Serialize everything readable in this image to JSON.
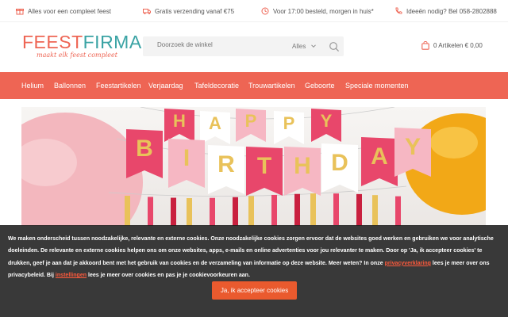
{
  "usp": [
    {
      "text": "Alles voor een compleet feest",
      "icon": "gift-icon"
    },
    {
      "text": "Gratis verzending vanaf €75",
      "icon": "truck-icon"
    },
    {
      "text": "Voor 17:00 besteld, morgen in huis*",
      "icon": "clock-icon"
    },
    {
      "text": "Ideeën nodig? Bel 058-2802888",
      "icon": "phone-icon"
    }
  ],
  "logo": {
    "part1": "FEEST",
    "part2": "FIRMA",
    "tagline": "maakt elk feest compleet"
  },
  "search": {
    "placeholder": "Doorzoek de winkel",
    "category": "Alles"
  },
  "cart": {
    "label": "0 Artikelen € 0,00"
  },
  "nav": [
    "Helium",
    "Ballonnen",
    "Feestartikelen",
    "Verjaardag",
    "Tafeldecoratie",
    "Trouwartikelen",
    "Geboorte",
    "Speciale momenten"
  ],
  "hero": {
    "flags_top": [
      "H",
      "A",
      "P",
      "P",
      "Y"
    ],
    "flags_bottom": [
      "B",
      "I",
      "R",
      "T",
      "H",
      "D",
      "A",
      "Y"
    ]
  },
  "cookie": {
    "p1": "We maken onderscheid tussen noodzakelijke, relevante en externe cookies. Onze noodzakelijke cookies zorgen ervoor dat de websites goed werken en gebruiken we voor analytische doeleinden. De relevante en externe cookies helpen ons om onze websites, apps, e-mails en online advertenties voor jou relevanter te maken. Door op 'Ja, ik accepteer cookies' te drukken, geef je aan dat je akkoord bent met het gebruik van cookies en de verzameling van informatie op deze website. Meer weten? In onze ",
    "link1": "privacyverklaring",
    "p2": " lees je meer over ons privacybeleid. Bij ",
    "link2": "instellingen",
    "p3": " lees je meer over cookies en pas je je cookievoorkeuren aan.",
    "button": "Ja, ik accepteer cookies"
  },
  "colors": {
    "brand": "#ee6554",
    "brand_teal": "#3aa3a4",
    "button": "#ea5a2e"
  }
}
